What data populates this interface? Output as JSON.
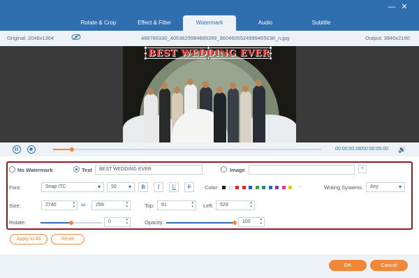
{
  "tabs": [
    {
      "label": "Rotate & Crop"
    },
    {
      "label": "Effect & Filter"
    },
    {
      "label": "Watermark"
    },
    {
      "label": "Audio"
    },
    {
      "label": "Subtitle"
    }
  ],
  "active_tab": "Watermark",
  "info": {
    "original": "Original: 2048x1364",
    "filename": "488789330_4053829984889399_8604605524999465038_n.jpg",
    "output": "Output: 3840x2160"
  },
  "preview": {
    "watermark_text": "BEST WEDDING EVER",
    "watermark_color": "#e3262b"
  },
  "playback": {
    "time": "00:00:00.08/00:00:05.00",
    "progress": 0.07
  },
  "watermark": {
    "no_watermark_label": "No Watermark",
    "text_label": "Text",
    "text_value": "BEST WEDDING EVER",
    "image_label": "Image",
    "image_value": "",
    "selected": "Text"
  },
  "font": {
    "label": "Font:",
    "family": "Snap ITC",
    "size": "50",
    "bold": "B",
    "italic": "I",
    "underline": "U",
    "strike": "F"
  },
  "color": {
    "label": "Color:",
    "swatches": [
      "#1b1b1b",
      "#ffffff",
      "#d62a2a",
      "#e3262b",
      "#2d58c9",
      "#3aa14f",
      "#1f8f7a",
      "#2f6fb0",
      "#7b3fbf",
      "#d63fa4",
      "#f0c419"
    ],
    "more": "···"
  },
  "writing_systems": {
    "label": "Writing Systems:",
    "value": "Any"
  },
  "size": {
    "label": "Size:",
    "width": "2740",
    "height": "259"
  },
  "position": {
    "top_label": "Top:",
    "top": "61",
    "left_label": "Left:",
    "left": "529"
  },
  "rotate": {
    "label": "Rotate:",
    "value": "0",
    "level": 0.5
  },
  "opacity": {
    "label": "Opacity:",
    "value": "100",
    "level": 1.0
  },
  "buttons": {
    "apply_all": "Apply to All",
    "reset": "Reset",
    "ok": "OK",
    "cancel": "Cancel"
  },
  "colors": {
    "brand_blue": "#2f6fb0",
    "accent_orange": "#f0883a",
    "panel_border": "#8a1c22"
  }
}
